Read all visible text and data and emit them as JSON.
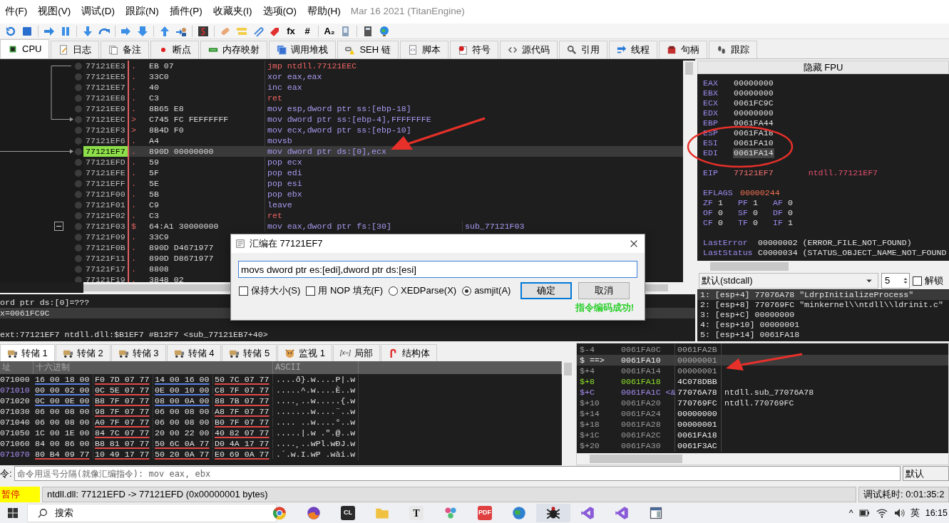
{
  "menu": [
    "件(F)",
    "视图(V)",
    "调试(D)",
    "跟踪(N)",
    "插件(P)",
    "收藏夹(I)",
    "选项(O)",
    "帮助(H)"
  ],
  "build": "Mar 16 2021 (TitanEngine)",
  "toolbar": {
    "glyphs": [
      "fx",
      "#",
      "A₂"
    ]
  },
  "tabs": [
    {
      "label": "CPU",
      "selected": true
    },
    {
      "label": "日志",
      "selected": false
    },
    {
      "label": "备注",
      "selected": false
    },
    {
      "label": "断点",
      "selected": false
    },
    {
      "label": "内存映射",
      "selected": false
    },
    {
      "label": "调用堆栈",
      "selected": false
    },
    {
      "label": "SEH 链",
      "selected": false
    },
    {
      "label": "脚本",
      "selected": false
    },
    {
      "label": "符号",
      "selected": false
    },
    {
      "label": "源代码",
      "selected": false
    },
    {
      "label": "引用",
      "selected": false
    },
    {
      "label": "线程",
      "selected": false
    },
    {
      "label": "句柄",
      "selected": false
    },
    {
      "label": "跟踪",
      "selected": false
    }
  ],
  "disassembly": {
    "rows": [
      {
        "address": "77121EE3",
        "marker": ".",
        "bytes": "EB 07",
        "instruction": "jmp ntdll.77121EEC",
        "kind": "jump",
        "selected": false,
        "fold": false
      },
      {
        "address": "77121EE5",
        "marker": ".",
        "bytes": "33C0",
        "instruction": "xor eax,eax",
        "kind": "normal",
        "selected": false,
        "fold": false
      },
      {
        "address": "77121EE7",
        "marker": ".",
        "bytes": "40",
        "instruction": "inc eax",
        "kind": "normal",
        "selected": false,
        "fold": false
      },
      {
        "address": "77121EE8",
        "marker": ".",
        "bytes": "C3",
        "instruction": "ret",
        "kind": "return",
        "selected": false,
        "fold": false
      },
      {
        "address": "77121EE9",
        "marker": ".",
        "bytes": "8B65 E8",
        "instruction": "mov esp,dword ptr ss:[ebp-18]",
        "kind": "normal",
        "selected": false,
        "fold": false
      },
      {
        "address": "77121EEC",
        "marker": ">",
        "bytes": "C745 FC FEFFFFFF",
        "instruction": "mov dword ptr ss:[ebp-4],FFFFFFFE",
        "kind": "normal",
        "selected": false,
        "fold": false
      },
      {
        "address": "77121EF3",
        "marker": ">",
        "bytes": "8B4D F0",
        "instruction": "mov ecx,dword ptr ss:[ebp-10]",
        "kind": "normal",
        "selected": false,
        "fold": false
      },
      {
        "address": "77121EF6",
        "marker": ".",
        "bytes": "A4",
        "instruction": "movsb",
        "kind": "normal",
        "selected": false,
        "fold": false
      },
      {
        "address": "77121EF7",
        "marker": ".",
        "bytes": "890D 00000000",
        "instruction": "mov dword ptr ds:[0],ecx",
        "kind": "normal",
        "selected": true,
        "fold": false
      },
      {
        "address": "77121EFD",
        "marker": ".",
        "bytes": "59",
        "instruction": "pop ecx",
        "kind": "normal",
        "selected": false,
        "fold": false
      },
      {
        "address": "77121EFE",
        "marker": ".",
        "bytes": "5F",
        "instruction": "pop edi",
        "kind": "normal",
        "selected": false,
        "fold": false
      },
      {
        "address": "77121EFF",
        "marker": ".",
        "bytes": "5E",
        "instruction": "pop esi",
        "kind": "normal",
        "selected": false,
        "fold": false
      },
      {
        "address": "77121F00",
        "marker": ".",
        "bytes": "5B",
        "instruction": "pop ebx",
        "kind": "normal",
        "selected": false,
        "fold": false
      },
      {
        "address": "77121F01",
        "marker": ".",
        "bytes": "C9",
        "instruction": "leave",
        "kind": "normal",
        "selected": false,
        "fold": false
      },
      {
        "address": "77121F02",
        "marker": ".",
        "bytes": "C3",
        "instruction": "ret",
        "kind": "return",
        "selected": false,
        "fold": false
      },
      {
        "address": "77121F03",
        "marker": "$",
        "bytes": "64:A1 30000000",
        "instruction": "mov eax,dword ptr fs:[30]",
        "comment": "sub_77121F03",
        "kind": "normal",
        "selected": false,
        "fold": true
      },
      {
        "address": "77121F09",
        "marker": ".",
        "bytes": "33C9",
        "selected": false,
        "fold": false
      },
      {
        "address": "77121F0B",
        "marker": ".",
        "bytes": "890D D4671977",
        "selected": false,
        "fold": false
      },
      {
        "address": "77121F11",
        "marker": ".",
        "bytes": "890D D8671977",
        "selected": false,
        "fold": false
      },
      {
        "address": "77121F17",
        "marker": ".",
        "bytes": "8808",
        "selected": false,
        "fold": false
      },
      {
        "address": "77121F19",
        "marker": ".",
        "bytes": "3848 02",
        "selected": false,
        "fold": false
      }
    ],
    "info": [
      {
        "text": "ord ptr ds:[0]=???",
        "selected": false
      },
      {
        "text": "x=0061FC9C",
        "selected": true
      },
      {
        "text": "ext:77121EF7 ntdll.dll:$B1EF7 #B12F7 <sub_77121EB7+40>",
        "selected": false
      }
    ]
  },
  "registers": {
    "header": "隐藏 FPU",
    "general": [
      {
        "name": "EAX",
        "value": "00000000",
        "selected": false
      },
      {
        "name": "EBX",
        "value": "00000000",
        "selected": false
      },
      {
        "name": "ECX",
        "value": "0061FC9C",
        "selected": false
      },
      {
        "name": "EDX",
        "value": "00000000",
        "selected": false
      },
      {
        "name": "EBP",
        "value": "0061FA44",
        "selected": false
      },
      {
        "name": "ESP",
        "value": "0061FA18",
        "selected": false
      },
      {
        "name": "ESI",
        "value": "0061FA10",
        "selected": false
      },
      {
        "name": "EDI",
        "value": "0061FA14",
        "selected": true
      }
    ],
    "eip": {
      "name": "EIP",
      "value": "77121EF7",
      "comment": "ntdll.77121EF7"
    },
    "eflags": {
      "name": "EFLAGS",
      "value": "00000244"
    },
    "flags": [
      {
        "name": "ZF",
        "value": "1"
      },
      {
        "name": "PF",
        "value": "1"
      },
      {
        "name": "AF",
        "value": "0"
      },
      {
        "name": "OF",
        "value": "0"
      },
      {
        "name": "SF",
        "value": "0"
      },
      {
        "name": "DF",
        "value": "0"
      },
      {
        "name": "CF",
        "value": "0"
      },
      {
        "name": "TF",
        "value": "0"
      },
      {
        "name": "IF",
        "value": "1"
      }
    ],
    "errors": [
      {
        "name": "LastError",
        "value": "00000002 (ERROR_FILE_NOT_FOUND)"
      },
      {
        "name": "LastStatus",
        "value": "C0000034 (STATUS_OBJECT_NAME_NOT_FOUND"
      }
    ]
  },
  "call_convention": {
    "value": "默认(stdcall)",
    "count": "5",
    "lock_label": "解锁",
    "lock_checked": false
  },
  "arguments": [
    {
      "text": "1: [esp+4] 77076A78 \"LdrpInitializeProcess\"",
      "selected": true
    },
    {
      "text": "2: [esp+8] 770769FC \"minkernel\\\\ntdll\\\\ldrinit.c\"",
      "selected": false
    },
    {
      "text": "3: [esp+C] 00000000",
      "selected": false
    },
    {
      "text": "4: [esp+10] 00000001",
      "selected": false
    },
    {
      "text": "5: [esp+14] 0061FA18",
      "selected": false
    }
  ],
  "dump_tabs": [
    {
      "label": "转储 1",
      "kind": "truck",
      "selected": true
    },
    {
      "label": "转储 2",
      "kind": "truck",
      "selected": false
    },
    {
      "label": "转储 3",
      "kind": "truck",
      "selected": false
    },
    {
      "label": "转储 4",
      "kind": "truck",
      "selected": false
    },
    {
      "label": "转储 5",
      "kind": "truck",
      "selected": false
    },
    {
      "label": "监视 1",
      "kind": "face",
      "selected": false
    },
    {
      "label": "局部",
      "kind": "glyph",
      "glyph": "[x=]",
      "selected": false
    },
    {
      "label": "结构体",
      "kind": "cane",
      "selected": false
    }
  ],
  "dump": {
    "columns": [
      "址",
      "十六进制",
      "ASCII"
    ],
    "rows": [
      {
        "address": "071000",
        "color": "#e0e0e0",
        "groups": [
          {
            "text": "16 00 18 00",
            "color": "#5a7fe0"
          },
          {
            "text": "F0 7D 07 77",
            "color": "#e04848"
          },
          {
            "text": "14 00 16 00",
            "color": "#5a7fe0"
          },
          {
            "text": "50 7C 07 77",
            "color": "#e04848"
          }
        ],
        "ascii": "....ð}.w....P|.w"
      },
      {
        "address": "071010",
        "color": "#a58cf0",
        "groups": [
          {
            "text": "00 00 02 00",
            "color": "#5a7fe0"
          },
          {
            "text": "0C 5E 07 77",
            "color": "#e04848"
          },
          {
            "text": "0E 00 10 00",
            "color": "#5a7fe0"
          },
          {
            "text": "C8 7F 07 77",
            "color": "#e04848"
          }
        ],
        "ascii": ".....^.w....È..w"
      },
      {
        "address": "071020",
        "color": "#e0e0e0",
        "groups": [
          {
            "text": "0C 00 0E 00",
            "color": "#5a7fe0"
          },
          {
            "text": "B8 7F 07 77",
            "color": "#e04848"
          },
          {
            "text": "08 00 0A 00",
            "color": "#5a7fe0"
          },
          {
            "text": "88 7B 07 77",
            "color": "#e04848"
          }
        ],
        "ascii": "....¸..w.....{.w"
      },
      {
        "address": "071030",
        "color": "#e0e0e0",
        "groups": [
          {
            "text": "06 00 08 00"
          },
          {
            "text": "98 7F 07 77",
            "color": "#e04848"
          },
          {
            "text": "06 00 08 00"
          },
          {
            "text": "A8 7F 07 77",
            "color": "#e04848"
          }
        ],
        "ascii": ".......w....¨..w"
      },
      {
        "address": "071040",
        "color": "#e0e0e0",
        "groups": [
          {
            "text": "06 00 08 00"
          },
          {
            "text": "A0 7F 07 77",
            "color": "#e04848"
          },
          {
            "text": "06 00 08 00"
          },
          {
            "text": "B0 7F 07 77",
            "color": "#e04848"
          }
        ],
        "ascii": ".... ..w....°..w"
      },
      {
        "address": "071050",
        "color": "#e0e0e0",
        "groups": [
          {
            "text": "1C 00 1E 00"
          },
          {
            "text": "84 7C 07 77",
            "color": "#e04848"
          },
          {
            "text": "20 00 22 00"
          },
          {
            "text": "40 82 07 77",
            "color": "#e04848"
          }
        ],
        "ascii": ".....|.w .\".@..w"
      },
      {
        "address": "071060",
        "color": "#e0e0e0",
        "groups": [
          {
            "text": "84 00 86 00"
          },
          {
            "text": "B8 81 07 77",
            "color": "#e04848"
          },
          {
            "text": "50 6C 0A 77",
            "color": "#e04848"
          },
          {
            "text": "D0 4A 17 77",
            "color": "#e04848"
          }
        ],
        "ascii": "....¸..wPl.wÐJ.w"
      },
      {
        "address": "071070",
        "color": "#a58cf0",
        "groups": [
          {
            "text": "80 B4 09 77",
            "color": "#e04848"
          },
          {
            "text": "10 49 17 77",
            "color": "#e04848"
          },
          {
            "text": "50 20 0A 77",
            "color": "#e04848"
          },
          {
            "text": "E0 69 0A 77",
            "color": "#e04848"
          }
        ],
        "ascii": ".´.w.I.wP .wài.w"
      }
    ]
  },
  "stack": [
    {
      "offset": "$-4",
      "address": "0061FA0C",
      "value": "0061FA2B",
      "kind": "plain",
      "selected": false
    },
    {
      "offset": "$ ==>",
      "address": "0061FA10",
      "value": "00000001",
      "kind": "top",
      "selected": true
    },
    {
      "offset": "$+4",
      "address": "0061FA14",
      "value": "00000001",
      "kind": "plain",
      "selected": false
    },
    {
      "offset": "$+8",
      "address": "0061FA18",
      "value": "4C078DBB",
      "kind": "data",
      "selected": false
    },
    {
      "offset": "$+C",
      "address": "0061FA1C <&",
      "value": "77076A78",
      "comment": "ntdll.sub_77076A78",
      "kind": "code",
      "selected": false
    },
    {
      "offset": "$+10",
      "address": "0061FA20",
      "value": "770769FC",
      "comment": "ntdll.770769FC",
      "kind": "plain",
      "selected": false
    },
    {
      "offset": "$+14",
      "address": "0061FA24",
      "value": "00000000",
      "kind": "plain",
      "selected": false
    },
    {
      "offset": "$+18",
      "address": "0061FA28",
      "value": "00000001",
      "kind": "plain",
      "selected": false
    },
    {
      "offset": "$+1C",
      "address": "0061FA2C",
      "value": "0061FA18",
      "kind": "plain",
      "selected": false
    },
    {
      "offset": "$+20",
      "address": "0061FA30",
      "value": "0061F3AC",
      "kind": "plain",
      "selected": false
    }
  ],
  "command": {
    "label": "令:",
    "placeholder": "命令用逗号分隔(就像汇编指令): mov eax, ebx",
    "mode": "默认"
  },
  "status": {
    "state": "暂停",
    "message": "ntdll.dll: 77121EFD -> 77121EFD (0x00000001 bytes)",
    "timer": "调试耗时: 0:01:35:2"
  },
  "dialog": {
    "title": "汇编在 77121EF7",
    "value": "movs dword ptr es:[edi],dword ptr ds:[esi]",
    "options": [
      {
        "kind": "checkbox",
        "label": "保持大小(S)",
        "checked": false
      },
      {
        "kind": "checkbox",
        "label": "用 NOP 填充(F)",
        "checked": false
      },
      {
        "kind": "radio",
        "label": "XEDParse(X)",
        "checked": false
      },
      {
        "kind": "radio",
        "label": "asmjit(A)",
        "checked": true
      }
    ],
    "buttons": [
      {
        "label": "确定",
        "default": true
      },
      {
        "label": "取消",
        "default": false
      }
    ],
    "message": "指令编码成功!"
  },
  "taskbar": {
    "search": "搜索",
    "apps": [
      {
        "kind": "browser",
        "selected": false
      },
      {
        "kind": "fox",
        "selected": false
      },
      {
        "kind": "lettered",
        "glyph": "CL",
        "selected": false
      },
      {
        "kind": "folder",
        "selected": false
      },
      {
        "kind": "lettered",
        "glyph": "T",
        "selected": false
      },
      {
        "kind": "network",
        "selected": false
      },
      {
        "kind": "lettered",
        "glyph": "PDF",
        "selected": false
      },
      {
        "kind": "globe",
        "selected": false
      },
      {
        "kind": "bug",
        "selected": true
      },
      {
        "kind": "studio",
        "selected": false
      },
      {
        "kind": "studio",
        "selected": false
      },
      {
        "kind": "window",
        "selected": false
      }
    ],
    "tray_chevron": "^",
    "ime": "英",
    "time": "16:15"
  }
}
